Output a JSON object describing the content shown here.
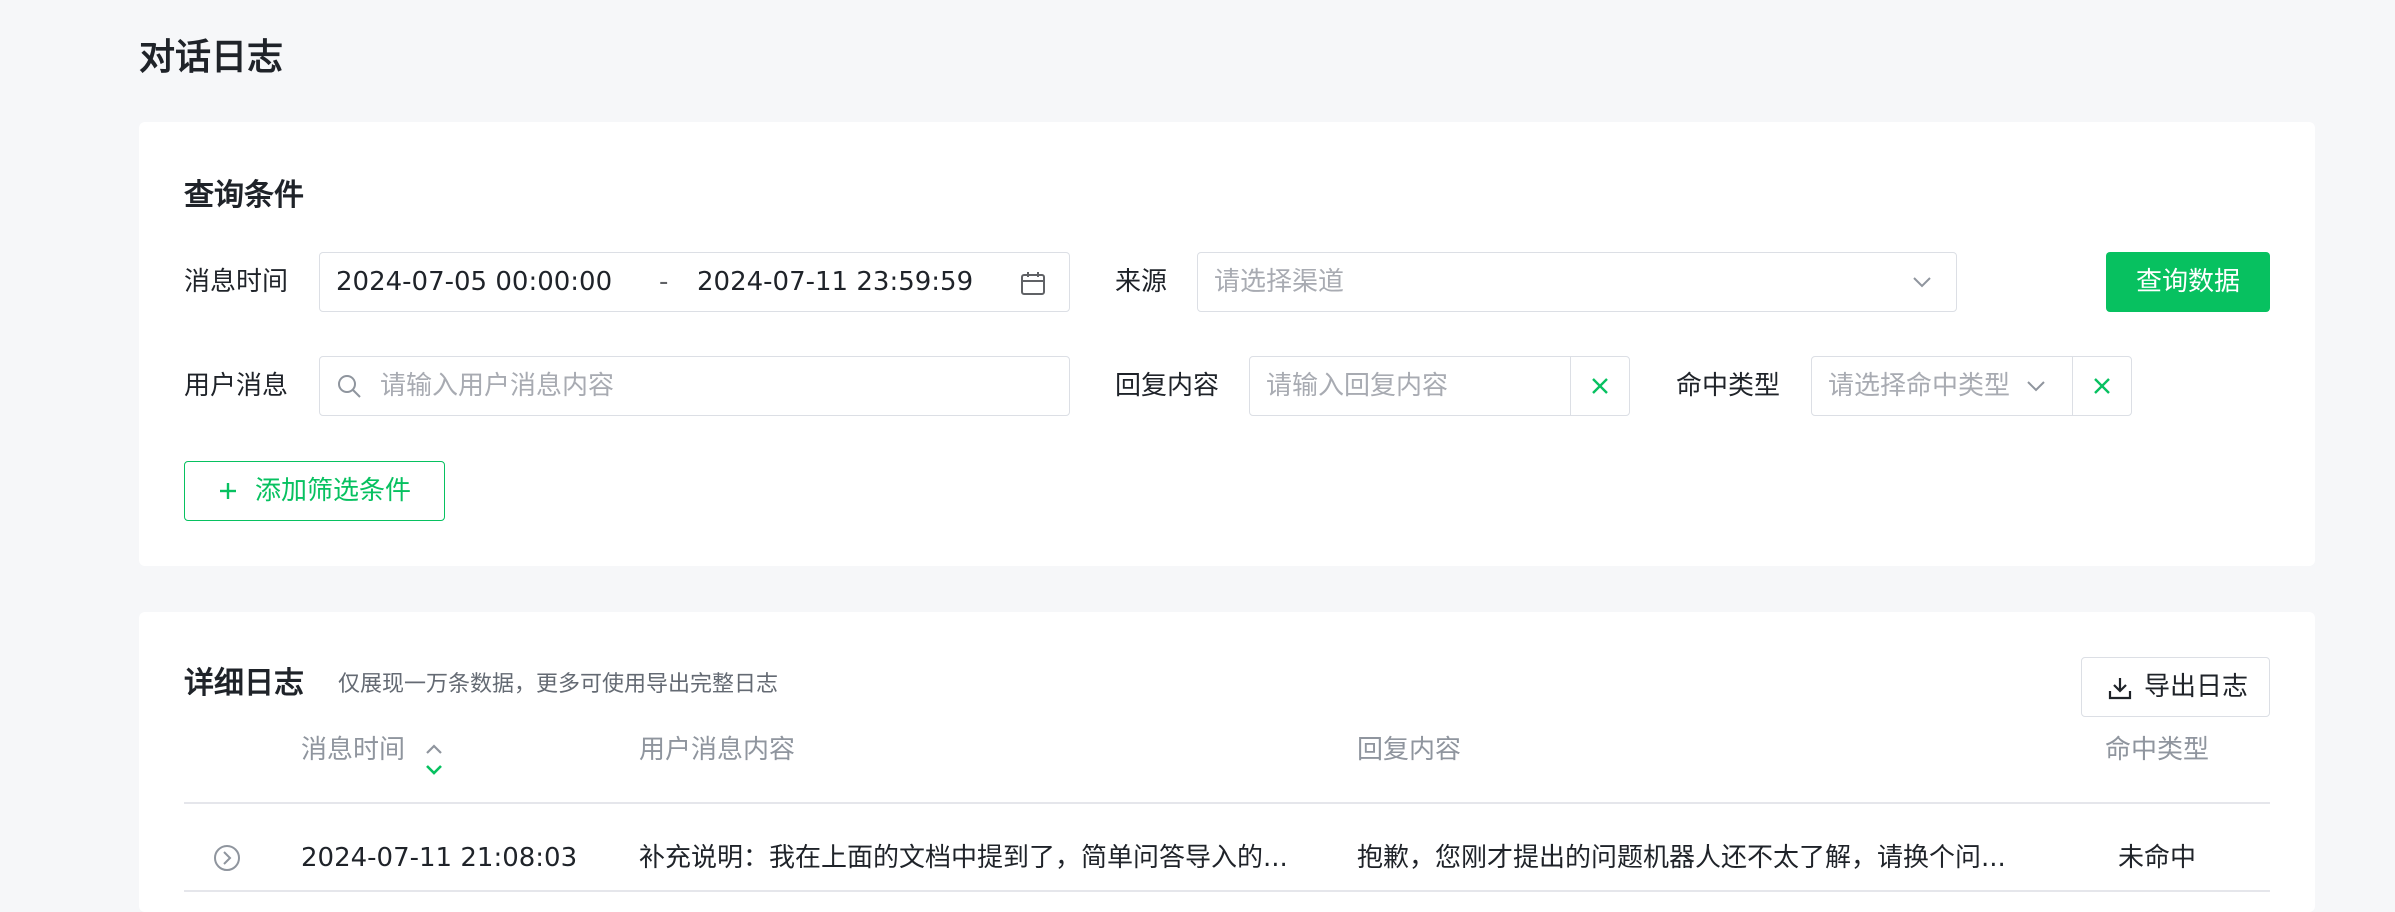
{
  "page": {
    "title": "对话日志"
  },
  "query": {
    "title": "查询条件",
    "time": {
      "label": "消息时间",
      "start": "2024-07-05 00:00:00",
      "separator": "-",
      "end": "2024-07-11 23:59:59"
    },
    "source": {
      "label": "来源",
      "placeholder": "请选择渠道"
    },
    "search_button": "查询数据",
    "user_message": {
      "label": "用户消息",
      "placeholder": "请输入用户消息内容"
    },
    "reply": {
      "label": "回复内容",
      "placeholder": "请输入回复内容"
    },
    "hit_type": {
      "label": "命中类型",
      "placeholder": "请选择命中类型"
    },
    "add_filter": {
      "icon": "plus",
      "label": "添加筛选条件"
    }
  },
  "log": {
    "title": "详细日志",
    "subtitle": "仅展现一万条数据，更多可使用导出完整日志",
    "export_button": "导出日志",
    "columns": [
      "消息时间",
      "用户消息内容",
      "回复内容",
      "命中类型"
    ],
    "rows": [
      {
        "time": "2024-07-11 21:08:03",
        "user_message": "补充说明：我在上面的文档中提到了，简单问答导入的...",
        "reply": "抱歉，您刚才提出的问题机器人还不太了解，请换个问...",
        "hit_type": "未命中"
      }
    ]
  },
  "theme": {
    "accent": "#07c160",
    "border": "#dcdfe5",
    "muted": "#8f959e",
    "placeholder": "#a8abb2"
  }
}
